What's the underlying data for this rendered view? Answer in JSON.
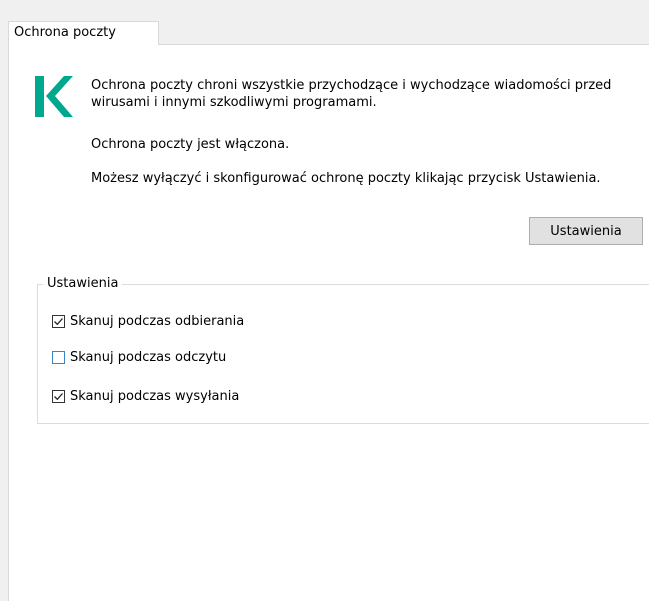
{
  "tab": {
    "label": "Ochrona poczty"
  },
  "colors": {
    "logo": "#00a88e",
    "panel": "#ffffff",
    "window": "#f0f0f0"
  },
  "content": {
    "description": "Ochrona poczty chroni wszystkie przychodzące i wychodzące wiadomości przed wirusami i innymi szkodliwymi programami.",
    "status": "Ochrona poczty jest włączona.",
    "hint": "Możesz wyłączyć i skonfigurować ochronę poczty klikając przycisk Ustawienia.",
    "settings_button": "Ustawienia"
  },
  "settings_group": {
    "legend": "Ustawienia",
    "options": [
      {
        "label": "Skanuj podczas odbierania",
        "checked": true
      },
      {
        "label": "Skanuj podczas odczytu",
        "checked": false
      },
      {
        "label": "Skanuj podczas wysyłania",
        "checked": true
      }
    ]
  }
}
